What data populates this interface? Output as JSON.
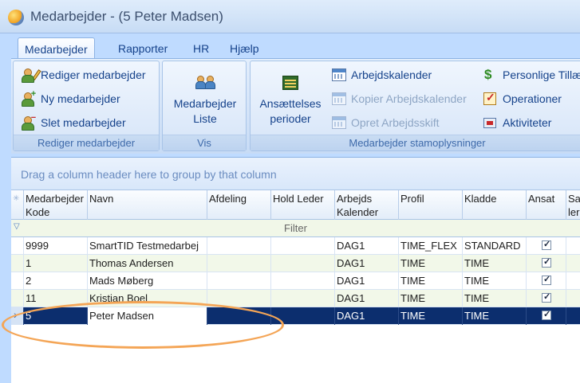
{
  "window": {
    "title": "Medarbejder - (5 Peter Madsen)"
  },
  "tabs": [
    {
      "label": "Medarbejder",
      "active": true
    },
    {
      "label": "Rapporter"
    },
    {
      "label": "HR"
    },
    {
      "label": "Hjælp"
    }
  ],
  "ribbon": {
    "edit_group": {
      "label": "Rediger medarbejder",
      "items": [
        "Rediger medarbejder",
        "Ny medarbejder",
        "Slet medarbejder"
      ]
    },
    "view_group": {
      "label": "Vis",
      "list_button": "Medarbejder Liste"
    },
    "master_group": {
      "label": "Medarbejder stamoplysninger",
      "employment_button": "Ansættelses perioder",
      "items": [
        {
          "label": "Arbejdskalender",
          "enabled": true
        },
        {
          "label": "Kopier Arbejdskalender",
          "enabled": false
        },
        {
          "label": "Opret Arbejdsskift",
          "enabled": false
        },
        {
          "label": "Personlige Tillæ",
          "enabled": true
        },
        {
          "label": "Operationer",
          "enabled": true
        },
        {
          "label": "Aktiviteter",
          "enabled": true
        }
      ]
    }
  },
  "grid": {
    "group_hint": "Drag a column header here to group by that column",
    "filter_label": "Filter",
    "columns": [
      "Medarbejder Kode",
      "Navn",
      "Afdeling",
      "Hold Leder",
      "Arbejds Kalender",
      "Profil",
      "Kladde",
      "Ansat",
      "Sa ler"
    ],
    "rows": [
      {
        "code": "9999",
        "name": "SmartTID Testmedarbej",
        "dept": "",
        "leader": "",
        "calendar": "DAG1",
        "profile": "TIME_FLEX",
        "draft": "STANDARD",
        "employed": true,
        "selected": false
      },
      {
        "code": "1",
        "name": "Thomas Andersen",
        "dept": "",
        "leader": "",
        "calendar": "DAG1",
        "profile": "TIME",
        "draft": "TIME",
        "employed": true,
        "selected": false
      },
      {
        "code": "2",
        "name": "Mads Møberg",
        "dept": "",
        "leader": "",
        "calendar": "DAG1",
        "profile": "TIME",
        "draft": "TIME",
        "employed": true,
        "selected": false
      },
      {
        "code": "11",
        "name": "Kristian Boel",
        "dept": "",
        "leader": "",
        "calendar": "DAG1",
        "profile": "TIME",
        "draft": "TIME",
        "employed": true,
        "selected": false
      },
      {
        "code": "5",
        "name": "Peter Madsen",
        "dept": "",
        "leader": "",
        "calendar": "DAG1",
        "profile": "TIME",
        "draft": "TIME",
        "employed": true,
        "selected": true
      }
    ]
  },
  "colors": {
    "selection": "#0c2e6e",
    "highlight_ring": "#f4a556",
    "ribbon_text": "#15428b"
  }
}
